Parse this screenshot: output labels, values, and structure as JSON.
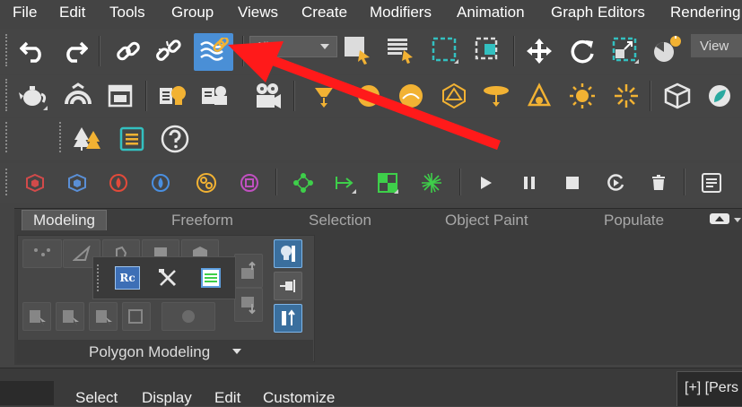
{
  "menubar": {
    "items": [
      "File",
      "Edit",
      "Tools",
      "Group",
      "Views",
      "Create",
      "Modifiers",
      "Animation",
      "Graph Editors",
      "Rendering"
    ]
  },
  "main_toolbar": {
    "selection_filter": "All",
    "view_dropdown": "View"
  },
  "ribbon": {
    "tabs": [
      "Modeling",
      "Freeform",
      "Selection",
      "Object Paint",
      "Populate"
    ],
    "active_tab": "Modeling",
    "panel_label": "Polygon Modeling"
  },
  "popup": {
    "rc_label": "Rc"
  },
  "bottom_menu": {
    "items": [
      "Select",
      "Display",
      "Edit",
      "Customize"
    ]
  },
  "viewport": {
    "label": "[+] [Pers"
  },
  "colors": {
    "accent_active": "#4a8fd6",
    "arrow": "#ff1a1a",
    "icon_orange": "#f2b233",
    "icon_teal": "#33c0c0",
    "icon_green": "#3ecf4a"
  }
}
